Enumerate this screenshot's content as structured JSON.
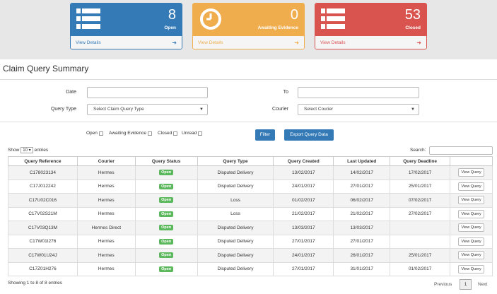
{
  "cards": [
    {
      "count": "8",
      "label": "Open",
      "link": "View Details",
      "color": "#337ab7",
      "icon": "list-icon"
    },
    {
      "count": "0",
      "label": "Awaiting Evidence",
      "link": "View Details",
      "color": "#f0ad4e",
      "icon": "clock-icon"
    },
    {
      "count": "53",
      "label": "Closed",
      "link": "View Details",
      "color": "#d9534f",
      "icon": "list-icon"
    }
  ],
  "page_title": "Claim Query Summary",
  "filters": {
    "date_label": "Date",
    "to_label": "To",
    "query_type_label": "Query Type",
    "query_type_value": "Select Claim Query Type",
    "courier_label": "Courier",
    "courier_value": "Select Courier",
    "checkboxes": [
      "Open",
      "Awaiting Evidence",
      "Closed",
      "Unread"
    ],
    "filter_button": "Filter",
    "export_button": "Export Query Data"
  },
  "table_controls": {
    "show_label": "Show",
    "show_value": "10",
    "entries_label": "entries",
    "search_label": "Search:"
  },
  "table": {
    "columns": [
      "Query Reference",
      "Courier",
      "Query Status",
      "Query Type",
      "Query Created",
      "Last Updated",
      "Query Deadline",
      ""
    ],
    "action_label": "View Query",
    "rows": [
      {
        "ref": "C178023134",
        "courier": "Hermes",
        "status": "Open",
        "type": "Disputed Delivery",
        "created": "13/02/2017",
        "updated": "14/02/2017",
        "deadline": "17/02/2017"
      },
      {
        "ref": "C17J012242",
        "courier": "Hermes",
        "status": "Open",
        "type": "Disputed Delivery",
        "created": "24/01/2017",
        "updated": "27/01/2017",
        "deadline": "25/01/2017"
      },
      {
        "ref": "C17U02C016",
        "courier": "Hermes",
        "status": "Open",
        "type": "Loss",
        "created": "01/02/2017",
        "updated": "06/02/2017",
        "deadline": "07/02/2017"
      },
      {
        "ref": "C17V02S21M",
        "courier": "Hermes",
        "status": "Open",
        "type": "Loss",
        "created": "21/02/2017",
        "updated": "21/02/2017",
        "deadline": "27/02/2017"
      },
      {
        "ref": "C17V03Q13M",
        "courier": "Hermes Direct",
        "status": "Open",
        "type": "Disputed Delivery",
        "created": "13/03/2017",
        "updated": "13/03/2017",
        "deadline": ""
      },
      {
        "ref": "C17W01I276",
        "courier": "Hermes",
        "status": "Open",
        "type": "Disputed Delivery",
        "created": "27/01/2017",
        "updated": "27/01/2017",
        "deadline": ""
      },
      {
        "ref": "C17W01U24J",
        "courier": "Hermes",
        "status": "Open",
        "type": "Disputed Delivery",
        "created": "24/01/2017",
        "updated": "26/01/2017",
        "deadline": "25/01/2017"
      },
      {
        "ref": "C17Z01H276",
        "courier": "Hermes",
        "status": "Open",
        "type": "Disputed Delivery",
        "created": "27/01/2017",
        "updated": "31/01/2017",
        "deadline": "01/02/2017"
      }
    ]
  },
  "footer": {
    "info": "Showing 1 to 8 of 8 entries",
    "previous": "Previous",
    "page": "1",
    "next": "Next"
  }
}
